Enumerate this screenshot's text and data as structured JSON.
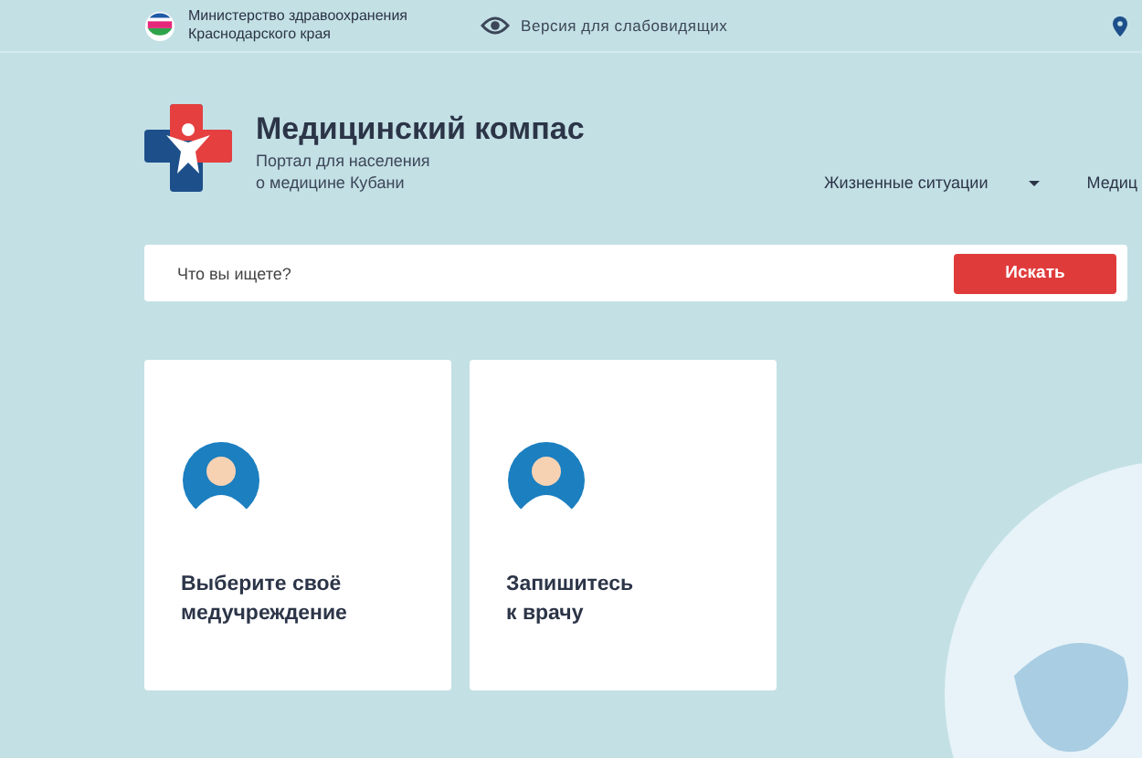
{
  "top_bar": {
    "ministry": [
      "Министерство здравоохранения",
      "Краснодарского края"
    ],
    "accessibility_link": "Версия для слабовидящих"
  },
  "header": {
    "title": "Медицинский компас",
    "subtitle": [
      "Портал для населения",
      "о медицине Кубани"
    ],
    "nav": [
      {
        "label": "Жизненные ситуации",
        "has_dropdown": true
      },
      {
        "label": "Медиц",
        "has_dropdown": false
      }
    ]
  },
  "search": {
    "placeholder": "Что вы ищете?",
    "button": "Искать"
  },
  "cards": [
    {
      "title": [
        "Выберите своё",
        "медучреждение"
      ]
    },
    {
      "title": [
        "Запишитесь",
        "к врачу"
      ]
    }
  ]
}
